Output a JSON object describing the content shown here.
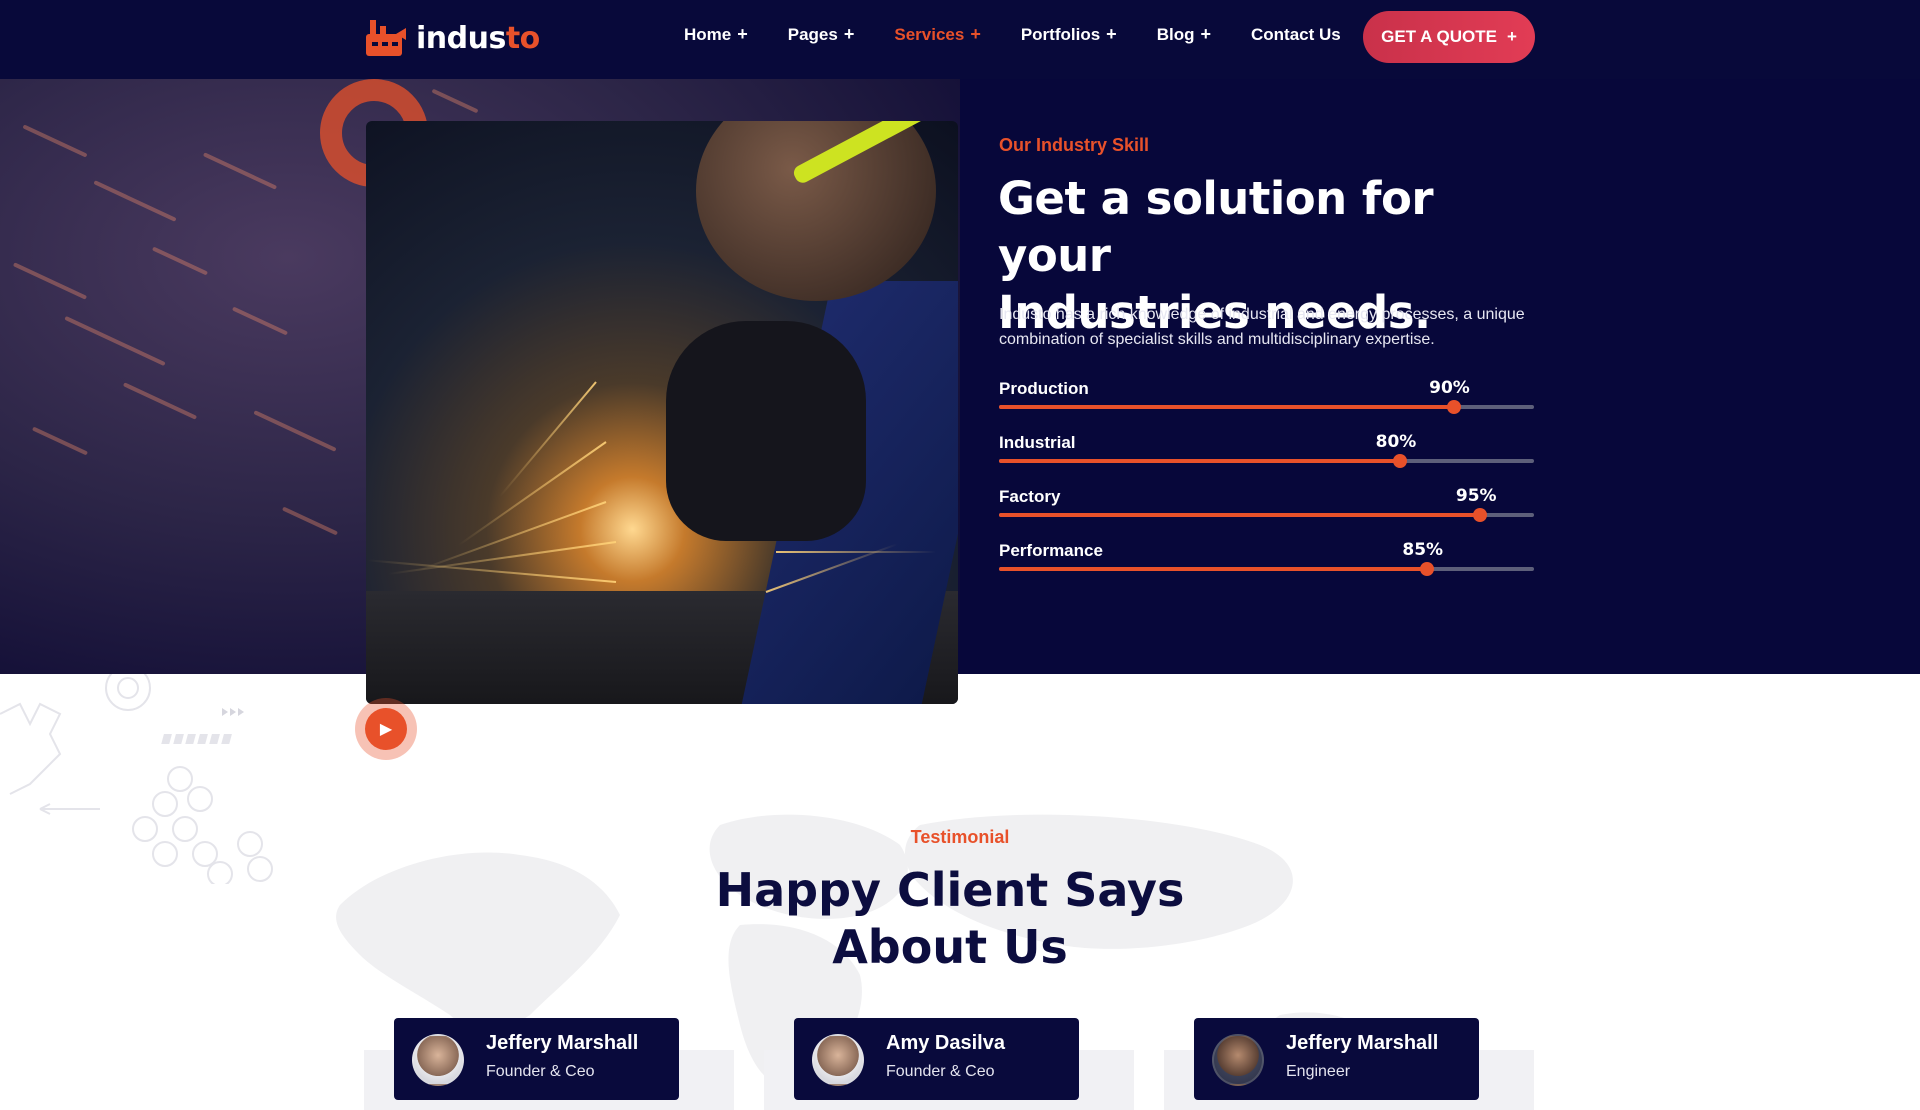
{
  "brand": {
    "name_main": "indus",
    "name_accent": "to"
  },
  "nav": {
    "items": [
      {
        "label": "Home",
        "suffix": "+",
        "active": false
      },
      {
        "label": "Pages",
        "suffix": "+",
        "active": false
      },
      {
        "label": "Services",
        "suffix": "+",
        "active": true
      },
      {
        "label": "Portfolios",
        "suffix": "+",
        "active": false
      },
      {
        "label": "Blog",
        "suffix": "+",
        "active": false
      },
      {
        "label": "Contact Us",
        "suffix": "",
        "active": false
      }
    ],
    "cta_label": "GET A QUOTE",
    "cta_suffix": "+"
  },
  "skills_section": {
    "eyebrow": "Our Industry Skill",
    "title_line1": "Get a solution for your",
    "title_line2": "Industries needs.",
    "description": "Industo has a rich knowledge of industrial and energy processes, a unique combination of specialist skills and multidisciplinary expertise.",
    "skills": [
      {
        "label": "Production",
        "value": 90,
        "value_text": "90%"
      },
      {
        "label": "Industrial",
        "value": 80,
        "value_text": "80%"
      },
      {
        "label": "Factory",
        "value": 95,
        "value_text": "95%"
      },
      {
        "label": "Performance",
        "value": 85,
        "value_text": "85%"
      }
    ]
  },
  "media": {
    "play_icon": "play-icon"
  },
  "testimonial": {
    "eyebrow": "Testimonial",
    "title_line1": "Happy Client Says",
    "title_line2": "About Us",
    "clients": [
      {
        "name": "Jeffery Marshall",
        "role": "Founder & Ceo"
      },
      {
        "name": "Amy Dasilva",
        "role": "Founder & Ceo"
      },
      {
        "name": "Jeffery Marshall",
        "role": "Engineer"
      }
    ]
  },
  "colors": {
    "navy": "#08093a",
    "accent": "#e8512a",
    "cta": "#d7354f"
  }
}
